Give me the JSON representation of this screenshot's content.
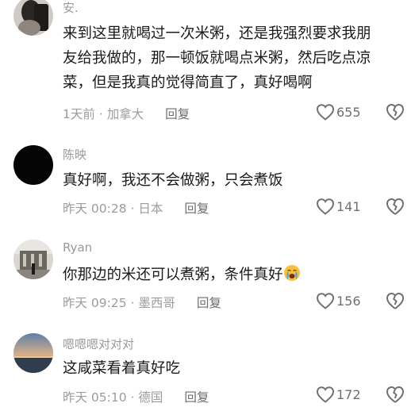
{
  "comments": [
    {
      "username": "安.",
      "lines": [
        "来到这里就喝过一次米粥，还是我强烈要求我朋",
        "友给我做的，那一顿饭就喝点米粥，然后吃点凉",
        "菜，但是我真的觉得简直了，真好喝啊"
      ],
      "time": "1天前",
      "location": "加拿大",
      "reply_label": "回复",
      "likes": "655"
    },
    {
      "username": "陈映",
      "lines": [
        "真好啊，我还不会做粥，只会煮饭"
      ],
      "time": "昨天 00:28",
      "location": "日本",
      "reply_label": "回复",
      "likes": "141"
    },
    {
      "username": "Ryan",
      "lines": [
        "你那边的米还可以煮粥，条件真好"
      ],
      "emoji": "crying-face-emoji",
      "time": "昨天 09:25",
      "location": "墨西哥",
      "reply_label": "回复",
      "likes": "156"
    },
    {
      "username": "嗯嗯嗯对对对",
      "lines": [
        "这咸菜看着真好吃"
      ],
      "time": "昨天 05:10",
      "location": "德国",
      "reply_label": "回复",
      "likes": "172"
    }
  ],
  "meta_separator": "·",
  "icons": {
    "like": "heart-outline-icon",
    "dislike": "broken-heart-icon"
  },
  "colors": {
    "meta_text": "#9c9c9c",
    "icon": "#6f6f6f"
  }
}
